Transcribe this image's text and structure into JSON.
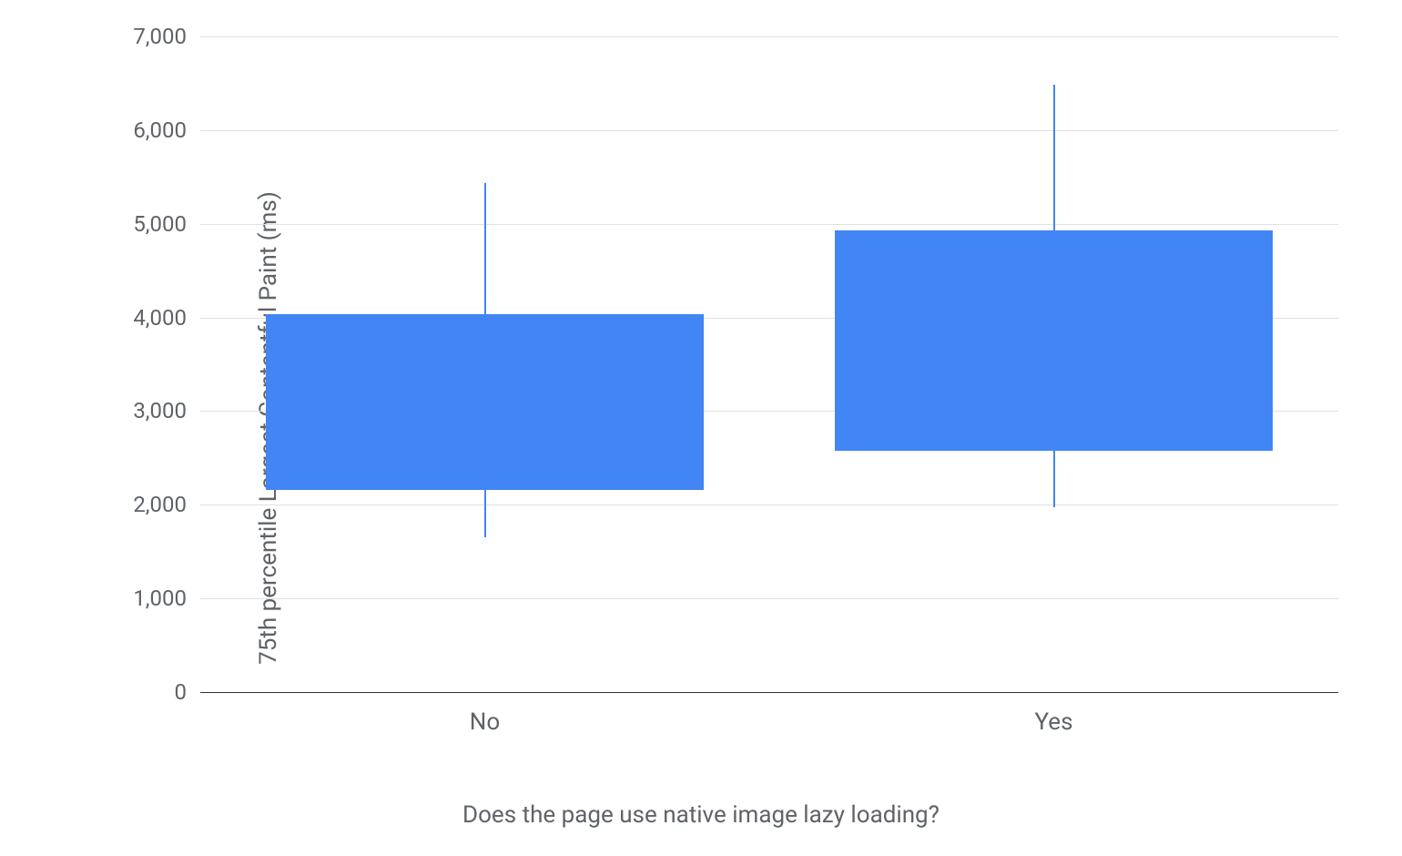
{
  "chart_data": {
    "type": "boxplot",
    "ylabel": "75th percentile Largest Contentful Paint (ms)",
    "xlabel": "Does the page use native image lazy loading?",
    "ylim": [
      0,
      7000
    ],
    "y_ticks": [
      0,
      1000,
      2000,
      3000,
      4000,
      5000,
      6000,
      7000
    ],
    "y_tick_labels": [
      "0",
      "1,000",
      "2,000",
      "3,000",
      "4,000",
      "5,000",
      "6,000",
      "7,000"
    ],
    "categories": [
      "No",
      "Yes"
    ],
    "series": [
      {
        "name": "No",
        "min": 1650,
        "q1": 2160,
        "q3": 4030,
        "max": 5430
      },
      {
        "name": "Yes",
        "min": 1970,
        "q1": 2580,
        "q3": 4930,
        "max": 6480
      }
    ],
    "box_color": "#4285f4"
  }
}
